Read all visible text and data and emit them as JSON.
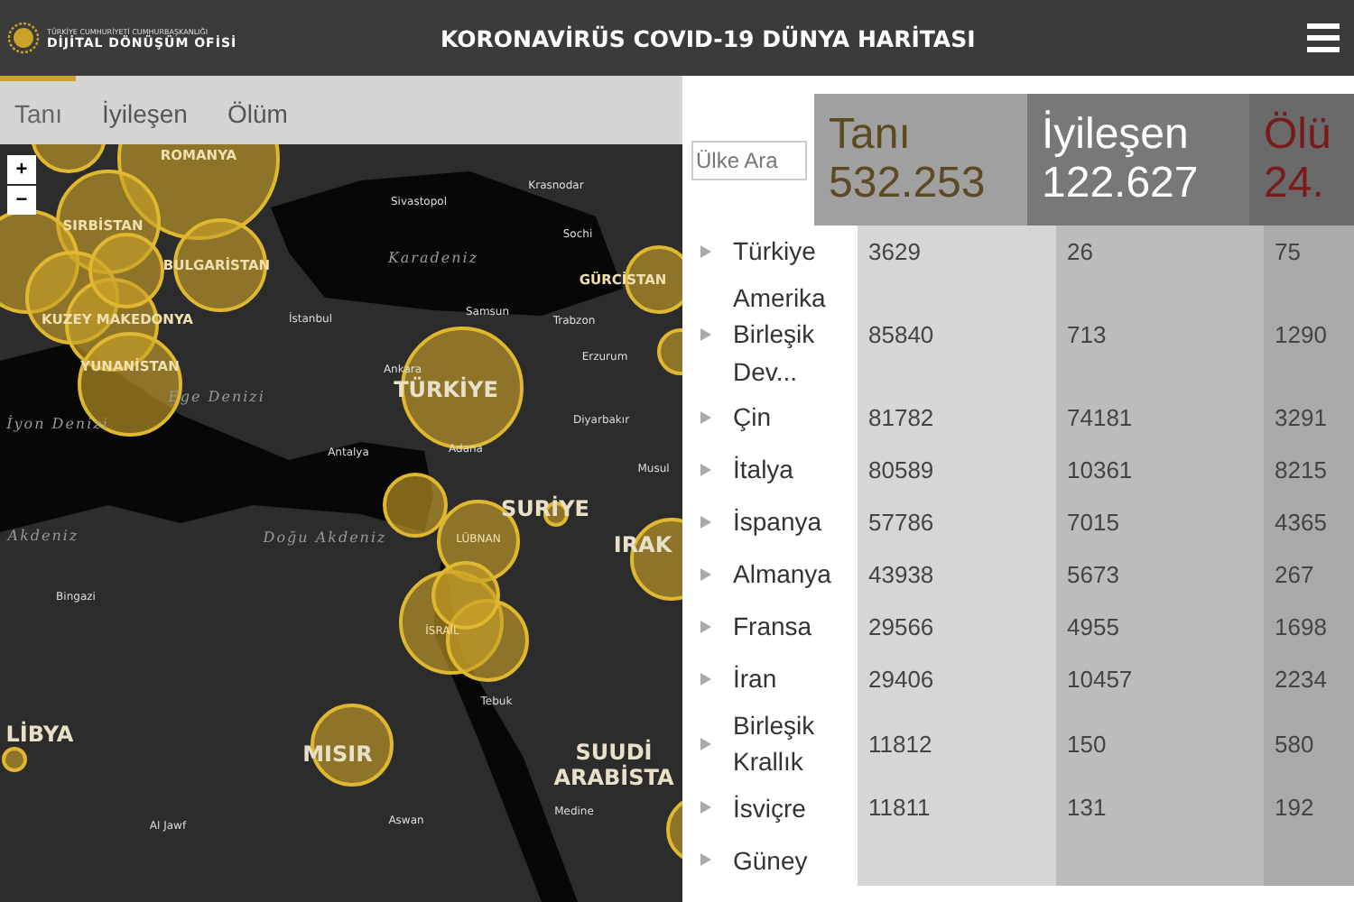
{
  "header": {
    "logo_small": "TÜRKİYE CUMHURİYETİ CUMHURBAŞKANLIĞI",
    "logo_big": "DİJİTAL DÖNÜŞÜM OFİSİ",
    "title": "KORONAVİRÜS COVID-19 DÜNYA HARİTASI"
  },
  "tabs": [
    {
      "label": "Tanı",
      "selected": true
    },
    {
      "label": "İyileşen",
      "selected": false
    },
    {
      "label": "Ölüm",
      "selected": false
    }
  ],
  "map": {
    "zoom_in": "+",
    "zoom_out": "−",
    "labels": [
      {
        "text": "ROMANYA",
        "kind": "country"
      },
      {
        "text": "SIRBİSTAN",
        "kind": "country"
      },
      {
        "text": "BULGARİSTAN",
        "kind": "country"
      },
      {
        "text": "KUZEY MAKEDONYA",
        "kind": "country"
      },
      {
        "text": "YUNANİSTAN",
        "kind": "country"
      },
      {
        "text": "TÜRKİYE",
        "kind": "big"
      },
      {
        "text": "GÜRCİSTAN",
        "kind": "country"
      },
      {
        "text": "Sivastopol",
        "kind": "city"
      },
      {
        "text": "Krasnodar",
        "kind": "city"
      },
      {
        "text": "Sochi",
        "kind": "city"
      },
      {
        "text": "Karadeniz",
        "kind": "sea"
      },
      {
        "text": "İstanbul",
        "kind": "city"
      },
      {
        "text": "Samsun",
        "kind": "city"
      },
      {
        "text": "Trabzon",
        "kind": "city"
      },
      {
        "text": "Erzurum",
        "kind": "city"
      },
      {
        "text": "Ankara",
        "kind": "city"
      },
      {
        "text": "Diyarbakır",
        "kind": "city"
      },
      {
        "text": "Antalya",
        "kind": "city"
      },
      {
        "text": "Adana",
        "kind": "city"
      },
      {
        "text": "Musul",
        "kind": "city"
      },
      {
        "text": "Ege Denizi",
        "kind": "sea"
      },
      {
        "text": "İyon Denizi",
        "kind": "sea"
      },
      {
        "text": "SURİYE",
        "kind": "big"
      },
      {
        "text": "LÜBNAN",
        "kind": "small"
      },
      {
        "text": "İSRAİL",
        "kind": "small"
      },
      {
        "text": "IRAK",
        "kind": "big"
      },
      {
        "text": "Akdeniz",
        "kind": "sea"
      },
      {
        "text": "Doğu Akdeniz",
        "kind": "sea"
      },
      {
        "text": "Bingazi",
        "kind": "city"
      },
      {
        "text": "Tebuk",
        "kind": "city"
      },
      {
        "text": "MISIR",
        "kind": "big"
      },
      {
        "text": "LİBYA",
        "kind": "big"
      },
      {
        "text": "SUUDİ ARABİSTA",
        "kind": "big"
      },
      {
        "text": "Al Jawf",
        "kind": "city"
      },
      {
        "text": "Aswan",
        "kind": "city"
      },
      {
        "text": "Medine",
        "kind": "city"
      }
    ]
  },
  "search": {
    "placeholder": "Ülke Ara"
  },
  "totals": [
    {
      "label": "Tanı",
      "value": "532.253"
    },
    {
      "label": "İyileşen",
      "value": "122.627"
    },
    {
      "label": "Ölü",
      "value": "24."
    }
  ],
  "rows": [
    {
      "country": "Türkiye",
      "cases": "3629",
      "recovered": "26",
      "deaths": "75"
    },
    {
      "country": "Amerika Birleşik Dev...",
      "cases": "85840",
      "recovered": "713",
      "deaths": "1290"
    },
    {
      "country": "Çin",
      "cases": "81782",
      "recovered": "74181",
      "deaths": "3291"
    },
    {
      "country": "İtalya",
      "cases": "80589",
      "recovered": "10361",
      "deaths": "8215"
    },
    {
      "country": "İspanya",
      "cases": "57786",
      "recovered": "7015",
      "deaths": "4365"
    },
    {
      "country": "Almanya",
      "cases": "43938",
      "recovered": "5673",
      "deaths": "267"
    },
    {
      "country": "Fransa",
      "cases": "29566",
      "recovered": "4955",
      "deaths": "1698"
    },
    {
      "country": "İran",
      "cases": "29406",
      "recovered": "10457",
      "deaths": "2234"
    },
    {
      "country": "Birleşik Krallık",
      "cases": "11812",
      "recovered": "150",
      "deaths": "580"
    },
    {
      "country": "İsviçre",
      "cases": "11811",
      "recovered": "131",
      "deaths": "192"
    },
    {
      "country": "Güney"
    }
  ]
}
